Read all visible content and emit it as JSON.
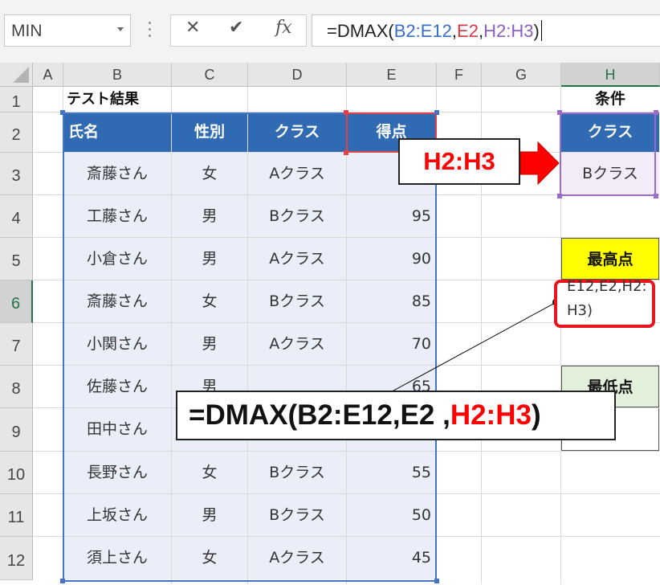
{
  "namebox": {
    "value": "MIN"
  },
  "fx": {
    "cancel": "✕",
    "enter": "✔",
    "fx": "fx"
  },
  "formula": {
    "parts": [
      {
        "text": "=DMAX(",
        "color": "#222222"
      },
      {
        "text": "B2:E12",
        "color": "#3a6fc9"
      },
      {
        "text": ",",
        "color": "#222222"
      },
      {
        "text": "E2",
        "color": "#d43a45"
      },
      {
        "text": ",",
        "color": "#222222"
      },
      {
        "text": "H2:H3",
        "color": "#8e5fbf"
      },
      {
        "text": ")",
        "color": "#222222"
      }
    ]
  },
  "columns": [
    "A",
    "B",
    "C",
    "D",
    "E",
    "F",
    "G",
    "H"
  ],
  "rows": [
    "1",
    "2",
    "3",
    "4",
    "5",
    "6",
    "7",
    "8",
    "9",
    "10",
    "11",
    "12"
  ],
  "selected": {
    "column": "H",
    "row": "6"
  },
  "sheet": {
    "title": "テスト結果",
    "headers": [
      "氏名",
      "性別",
      "クラス",
      "得点"
    ],
    "records": [
      [
        "斎藤さん",
        "女",
        "Aクラス",
        ""
      ],
      [
        "工藤さん",
        "男",
        "Bクラス",
        "95"
      ],
      [
        "小倉さん",
        "男",
        "Aクラス",
        "90"
      ],
      [
        "斎藤さん",
        "女",
        "Bクラス",
        "85"
      ],
      [
        "小関さん",
        "男",
        "Aクラス",
        "70"
      ],
      [
        "佐藤さん",
        "男",
        "",
        "65"
      ],
      [
        "田中さん",
        "",
        "",
        ""
      ],
      [
        "長野さん",
        "女",
        "Bクラス",
        "55"
      ],
      [
        "上坂さん",
        "男",
        "Bクラス",
        "50"
      ],
      [
        "須上さん",
        "女",
        "Aクラス",
        "45"
      ]
    ]
  },
  "criteria": {
    "label": "条件",
    "header": "クラス",
    "value": "Bクラス",
    "max_label": "最高点",
    "min_label": "最低点",
    "edit_line1": "E12,E2,H2:",
    "edit_line2": "H3)"
  },
  "callouts": {
    "range": "H2:H3",
    "formula_black": "=DMAX(B2:E12,E2 ,",
    "formula_red": "H2:H3",
    "formula_end": ")"
  },
  "colors": {
    "header_blue": "#2f6ab2",
    "body_blue": "#e9eef8",
    "max_yellow": "#ffff00",
    "min_green": "#e2efda",
    "accent_red": "#ff0000",
    "excel_green": "#217346"
  }
}
